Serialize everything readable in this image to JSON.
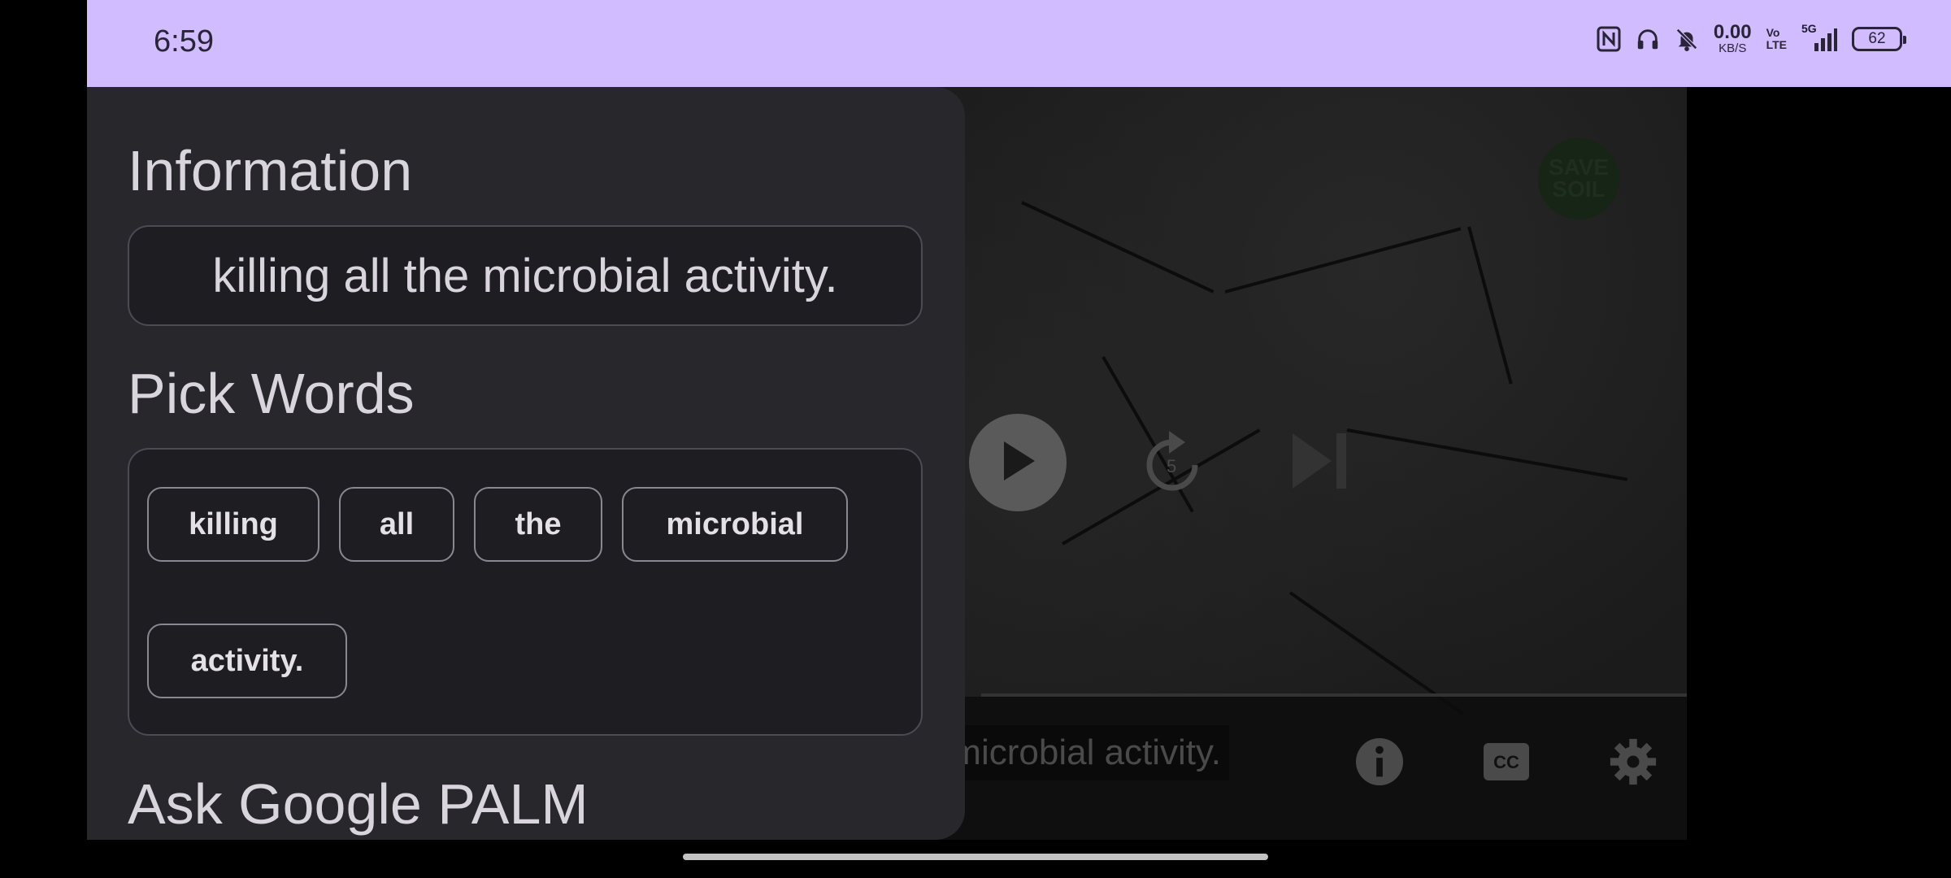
{
  "status_bar": {
    "time": "6:59",
    "net_speed_value": "0.00",
    "net_speed_unit": "KB/S",
    "volte_top": "Vo",
    "volte_bottom": "LTE",
    "network": "5G",
    "battery": "62",
    "background_color": "#d0bcfe"
  },
  "video": {
    "logo_line1": "SAVE",
    "logo_line2": "SOIL",
    "replay_seconds": "5",
    "caption": "microbial activity.",
    "icons": [
      "play-icon",
      "replay-5-icon",
      "skip-next-icon",
      "info-icon",
      "closed-caption-icon",
      "settings-icon",
      "fullscreen-icon",
      "transcript-icon"
    ]
  },
  "panel": {
    "information_title": "Information",
    "information_text": "killing all the microbial activity.",
    "pick_words_title": "Pick Words",
    "words": [
      "killing",
      "all",
      "the",
      "microbial",
      "activity."
    ],
    "ask_title": "Ask Google PALM"
  }
}
